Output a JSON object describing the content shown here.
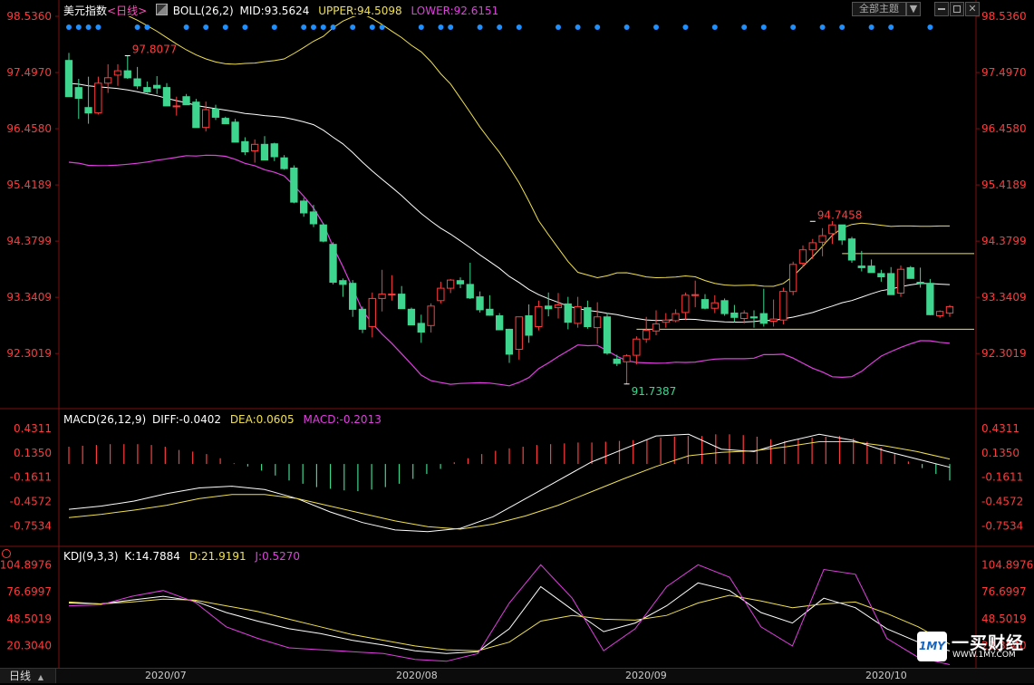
{
  "header": {
    "title": "美元指数",
    "period": "<日线>",
    "boll_label": "BOLL(26,2)",
    "mid": "MID:93.5624",
    "upper": "UPPER:94.5098",
    "lower": "LOWER:92.6151",
    "theme_button": "全部主题",
    "theme_arrow": "▼"
  },
  "macd_header": {
    "label": "MACD(26,12,9)",
    "diff": "DIFF:-0.0402",
    "dea": "DEA:0.0605",
    "macd": "MACD:-0.2013"
  },
  "kdj_header": {
    "label": "KDJ(9,3,3)",
    "k": "K:14.7884",
    "d": "D:21.9191",
    "j": "J:0.5270"
  },
  "bottom": {
    "period_tab": "日线",
    "dates": [
      "2020/07",
      "2020/08",
      "2020/09",
      "2020/10"
    ]
  },
  "watermark": {
    "brand_cn": "一买财经",
    "brand_url": "WWW.1MY.COM",
    "logo_text": "1MY"
  },
  "colors": {
    "up": "#ff3c3c",
    "down": "#3ed58f",
    "mid": "#ffffff",
    "upper": "#f0e050",
    "lower": "#e040e0",
    "axis_text": "#ff3a3a",
    "grid": "#7a1010",
    "signal_dot": "#1e90ff"
  },
  "chart_data": [
    {
      "type": "candlestick",
      "title": "美元指数 日线 BOLL(26,2)",
      "y_ticks": [
        "98.5360",
        "97.4970",
        "96.4580",
        "95.4189",
        "94.3799",
        "93.3409",
        "92.3019"
      ],
      "ylim": [
        91.3,
        98.536
      ],
      "x_tick_labels": [
        "2020/07",
        "2020/08",
        "2020/09",
        "2020/10"
      ],
      "annotations": [
        {
          "text": "97.8077",
          "value": 97.8077
        },
        {
          "text": "94.7458",
          "value": 94.7458
        },
        {
          "text": "91.7387",
          "value": 91.7387
        }
      ],
      "ohlc": [
        [
          97.72,
          97.86,
          97.05,
          97.05
        ],
        [
          97.22,
          97.38,
          96.64,
          97.02
        ],
        [
          96.85,
          97.42,
          96.55,
          96.75
        ],
        [
          96.75,
          97.42,
          96.72,
          97.3
        ],
        [
          97.3,
          97.65,
          97.12,
          97.4
        ],
        [
          97.45,
          97.65,
          97.25,
          97.53
        ],
        [
          97.53,
          97.81,
          97.38,
          97.4
        ],
        [
          97.38,
          97.6,
          97.19,
          97.25
        ],
        [
          97.22,
          97.33,
          97.12,
          97.14
        ],
        [
          97.26,
          97.43,
          97.1,
          97.21
        ],
        [
          97.22,
          97.3,
          96.93,
          96.88
        ],
        [
          96.88,
          97.05,
          96.7,
          96.88
        ],
        [
          97.05,
          97.1,
          96.9,
          96.9
        ],
        [
          96.95,
          97.01,
          96.55,
          96.48
        ],
        [
          96.48,
          96.96,
          96.41,
          96.81
        ],
        [
          96.82,
          96.9,
          96.62,
          96.67
        ],
        [
          96.65,
          96.68,
          96.55,
          96.55
        ],
        [
          96.58,
          96.64,
          96.21,
          96.21
        ],
        [
          96.22,
          96.3,
          95.97,
          96.03
        ],
        [
          96.05,
          96.26,
          95.83,
          96.17
        ],
        [
          96.17,
          96.32,
          95.88,
          95.88
        ],
        [
          96.18,
          96.2,
          95.86,
          95.94
        ],
        [
          95.92,
          95.97,
          95.7,
          95.72
        ],
        [
          95.73,
          95.78,
          95.08,
          95.1
        ],
        [
          95.12,
          95.18,
          94.83,
          94.9
        ],
        [
          94.92,
          95.05,
          94.64,
          94.7
        ],
        [
          94.68,
          94.71,
          94.36,
          94.38
        ],
        [
          94.32,
          94.36,
          93.58,
          93.62
        ],
        [
          93.65,
          93.69,
          93.35,
          93.58
        ],
        [
          93.6,
          93.66,
          92.98,
          93.12
        ],
        [
          93.12,
          93.17,
          92.68,
          92.75
        ],
        [
          92.8,
          93.43,
          92.6,
          93.32
        ],
        [
          93.32,
          93.85,
          93.08,
          93.4
        ],
        [
          93.4,
          93.75,
          93.28,
          93.4
        ],
        [
          93.4,
          93.55,
          93.15,
          93.13
        ],
        [
          93.12,
          93.15,
          92.83,
          92.83
        ],
        [
          92.86,
          93.02,
          92.5,
          92.7
        ],
        [
          92.82,
          93.23,
          92.69,
          93.18
        ],
        [
          93.28,
          93.63,
          93.23,
          93.51
        ],
        [
          93.51,
          93.68,
          93.42,
          93.66
        ],
        [
          93.65,
          93.71,
          93.51,
          93.59
        ],
        [
          93.58,
          93.98,
          93.31,
          93.33
        ],
        [
          93.35,
          93.45,
          93.06,
          93.11
        ],
        [
          93.12,
          93.38,
          93.0,
          93.01
        ],
        [
          93.0,
          93.05,
          92.74,
          92.74
        ],
        [
          92.75,
          92.76,
          92.13,
          92.29
        ],
        [
          92.38,
          92.98,
          92.19,
          92.98
        ],
        [
          93.0,
          93.21,
          92.5,
          92.64
        ],
        [
          92.8,
          93.28,
          92.73,
          93.17
        ],
        [
          93.18,
          93.43,
          92.99,
          93.13
        ],
        [
          93.15,
          93.42,
          92.95,
          93.2
        ],
        [
          93.22,
          93.35,
          92.75,
          92.88
        ],
        [
          92.86,
          93.35,
          92.78,
          93.17
        ],
        [
          93.15,
          93.28,
          92.76,
          92.8
        ],
        [
          92.78,
          93.25,
          92.48,
          92.98
        ],
        [
          92.98,
          93.05,
          92.28,
          92.31
        ],
        [
          92.2,
          92.28,
          92.07,
          92.12
        ],
        [
          92.15,
          92.29,
          91.74,
          92.26
        ],
        [
          92.27,
          92.62,
          92.1,
          92.57
        ],
        [
          92.57,
          92.98,
          92.5,
          92.73
        ],
        [
          92.72,
          93.1,
          92.64,
          92.85
        ],
        [
          92.88,
          93.05,
          92.78,
          92.92
        ],
        [
          92.91,
          93.12,
          92.88,
          93.04
        ],
        [
          93.06,
          93.43,
          92.93,
          93.38
        ],
        [
          93.38,
          93.65,
          93.16,
          93.39
        ],
        [
          93.3,
          93.4,
          93.12,
          93.14
        ],
        [
          93.14,
          93.38,
          93.05,
          93.24
        ],
        [
          93.28,
          93.32,
          93.0,
          93.04
        ],
        [
          93.05,
          93.2,
          92.88,
          92.97
        ],
        [
          92.95,
          93.1,
          92.86,
          93.05
        ],
        [
          92.98,
          93.1,
          92.78,
          92.96
        ],
        [
          93.04,
          93.5,
          92.8,
          92.86
        ],
        [
          92.9,
          93.3,
          92.8,
          92.94
        ],
        [
          92.92,
          93.52,
          92.84,
          93.45
        ],
        [
          93.45,
          94.0,
          93.38,
          93.95
        ],
        [
          93.97,
          94.3,
          93.9,
          94.22
        ],
        [
          94.22,
          94.42,
          94.05,
          94.35
        ],
        [
          94.36,
          94.62,
          94.1,
          94.48
        ],
        [
          94.52,
          94.75,
          94.33,
          94.68
        ],
        [
          94.68,
          94.68,
          94.31,
          94.4
        ],
        [
          94.42,
          94.46,
          93.98,
          94.03
        ],
        [
          93.92,
          94.2,
          93.82,
          93.89
        ],
        [
          93.92,
          94.04,
          93.8,
          93.8
        ],
        [
          93.78,
          93.85,
          93.63,
          93.72
        ],
        [
          93.78,
          93.9,
          93.4,
          93.39
        ],
        [
          93.42,
          93.93,
          93.35,
          93.86
        ],
        [
          93.89,
          93.92,
          93.7,
          93.69
        ],
        [
          93.62,
          93.89,
          93.52,
          93.6
        ],
        [
          93.6,
          93.68,
          93.01,
          93.02
        ],
        [
          93.0,
          93.1,
          92.96,
          93.08
        ],
        [
          93.05,
          93.2,
          92.98,
          93.17
        ]
      ],
      "series_extra": {
        "signal_dots_count": 30,
        "reference_lines": [
          94.15,
          92.75
        ]
      }
    },
    {
      "type": "line",
      "title": "MACD(26,12,9)",
      "y_ticks": [
        "0.4311",
        "0.1350",
        "-0.1611",
        "-0.4572",
        "-0.7534"
      ],
      "ylim": [
        -0.9,
        0.55
      ],
      "series": [
        {
          "name": "DIFF",
          "values": [
            -0.55,
            -0.51,
            -0.45,
            -0.36,
            -0.29,
            -0.27,
            -0.31,
            -0.42,
            -0.58,
            -0.71,
            -0.8,
            -0.82,
            -0.78,
            -0.64,
            -0.42,
            -0.2,
            0.02,
            0.18,
            0.34,
            0.36,
            0.18,
            0.15,
            0.27,
            0.36,
            0.29,
            0.16,
            0.06,
            -0.04
          ]
        },
        {
          "name": "DEA",
          "values": [
            -0.65,
            -0.61,
            -0.56,
            -0.5,
            -0.42,
            -0.37,
            -0.37,
            -0.42,
            -0.51,
            -0.6,
            -0.69,
            -0.76,
            -0.79,
            -0.73,
            -0.63,
            -0.5,
            -0.34,
            -0.18,
            -0.03,
            0.1,
            0.14,
            0.16,
            0.21,
            0.27,
            0.27,
            0.22,
            0.15,
            0.06
          ]
        }
      ],
      "histogram_values": [
        0.21,
        0.22,
        0.23,
        0.24,
        0.24,
        0.24,
        0.23,
        0.21,
        0.17,
        0.15,
        0.12,
        0.07,
        0.01,
        -0.03,
        -0.08,
        -0.14,
        -0.2,
        -0.24,
        -0.28,
        -0.3,
        -0.32,
        -0.33,
        -0.31,
        -0.28,
        -0.24,
        -0.18,
        -0.12,
        -0.06,
        0.02,
        0.07,
        0.12,
        0.16,
        0.19,
        0.21,
        0.23,
        0.24,
        0.25,
        0.26,
        0.26,
        0.27,
        0.28,
        0.29,
        0.3,
        0.32,
        0.33,
        0.34,
        0.34,
        0.36,
        0.36,
        0.35,
        0.33,
        0.3,
        0.28,
        0.3,
        0.32,
        0.33,
        0.34,
        0.31,
        0.27,
        0.2,
        0.12,
        0.03,
        -0.05,
        -0.12,
        -0.2
      ]
    },
    {
      "type": "line",
      "title": "KDJ(9,3,3)",
      "y_ticks": [
        "104.8976",
        "76.6997",
        "48.5019",
        "20.3040"
      ],
      "ylim": [
        0,
        110
      ],
      "series": [
        {
          "name": "K",
          "values": [
            65,
            64,
            68,
            72,
            67,
            55,
            46,
            38,
            33,
            26,
            21,
            15,
            12,
            14,
            38,
            82,
            58,
            35,
            44,
            62,
            86,
            78,
            55,
            44,
            70,
            60,
            38,
            24,
            14.8
          ]
        },
        {
          "name": "D",
          "values": [
            66,
            64,
            66,
            69,
            68,
            62,
            56,
            48,
            40,
            32,
            26,
            20,
            16,
            15,
            24,
            46,
            52,
            48,
            47,
            52,
            65,
            73,
            67,
            60,
            64,
            66,
            54,
            40,
            21.9
          ]
        },
        {
          "name": "J",
          "values": [
            62,
            63,
            72,
            78,
            66,
            40,
            28,
            18,
            16,
            14,
            12,
            6,
            4,
            12,
            65,
            105,
            70,
            15,
            38,
            82,
            105,
            92,
            40,
            20,
            100,
            95,
            28,
            8,
            0.5
          ]
        }
      ]
    }
  ]
}
